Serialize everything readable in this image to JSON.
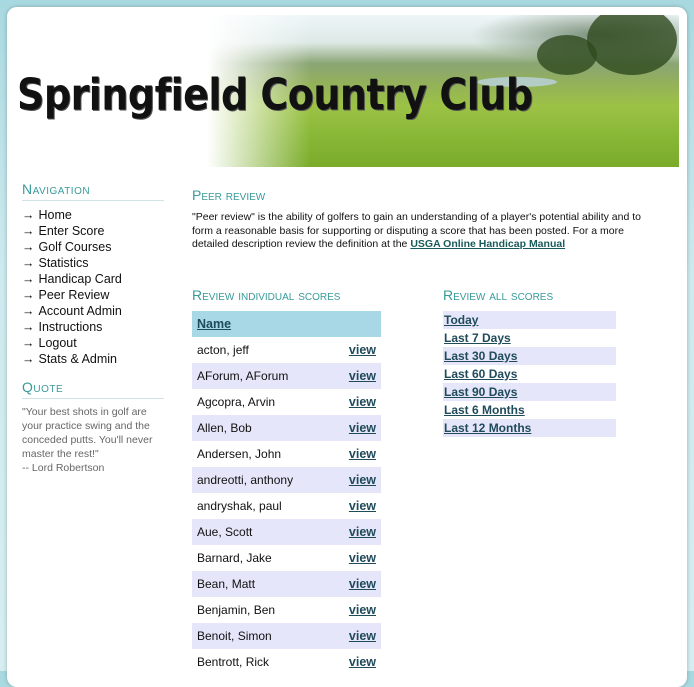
{
  "header": {
    "site_title": "Springfield Country Club"
  },
  "sidebar": {
    "nav_heading": "Navigation",
    "nav_items": [
      {
        "label": "Home"
      },
      {
        "label": "Enter Score"
      },
      {
        "label": "Golf Courses"
      },
      {
        "label": "Statistics"
      },
      {
        "label": "Handicap Card"
      },
      {
        "label": "Peer Review"
      },
      {
        "label": "Account Admin"
      },
      {
        "label": "Instructions"
      },
      {
        "label": "Logout"
      },
      {
        "label": "Stats & Admin"
      }
    ],
    "nav_arrow": "→",
    "quote_heading": "Quote",
    "quote_text": "\"Your best shots in golf are your practice swing and the conceded putts. You'll never master the rest!\"",
    "quote_author": "-- Lord Robertson"
  },
  "main": {
    "title": "Peer review",
    "intro_text": "\"Peer review\" is the ability of golfers to gain an understanding of a player's potential ability and to form a reasonable basis for supporting or disputing a score that has been posted. For a more detailed description review the definition at the ",
    "intro_link": "USGA Online Handicap Manual",
    "individual": {
      "heading": "Review individual scores",
      "column_header": "Name",
      "view_label": "view",
      "rows": [
        {
          "name": "acton, jeff"
        },
        {
          "name": "AForum, AForum"
        },
        {
          "name": "Agcopra, Arvin"
        },
        {
          "name": "Allen, Bob"
        },
        {
          "name": "Andersen, John"
        },
        {
          "name": "andreotti, anthony"
        },
        {
          "name": "andryshak, paul"
        },
        {
          "name": "Aue, Scott"
        },
        {
          "name": "Barnard, Jake"
        },
        {
          "name": "Bean, Matt"
        },
        {
          "name": "Benjamin, Ben"
        },
        {
          "name": "Benoit, Simon"
        },
        {
          "name": "Bentrott, Rick"
        }
      ]
    },
    "all": {
      "heading": "Review all scores",
      "periods": [
        {
          "label": "Today"
        },
        {
          "label": "Last 7 Days"
        },
        {
          "label": "Last 30 Days"
        },
        {
          "label": "Last 60 Days"
        },
        {
          "label": "Last 90 Days"
        },
        {
          "label": "Last 6 Months"
        },
        {
          "label": "Last 12 Months"
        }
      ]
    }
  },
  "colors": {
    "heading": "#3a9a9a",
    "table_header": "#a8d8e6",
    "alt_row": "#e6e6fb",
    "link": "#1f4a5a"
  }
}
